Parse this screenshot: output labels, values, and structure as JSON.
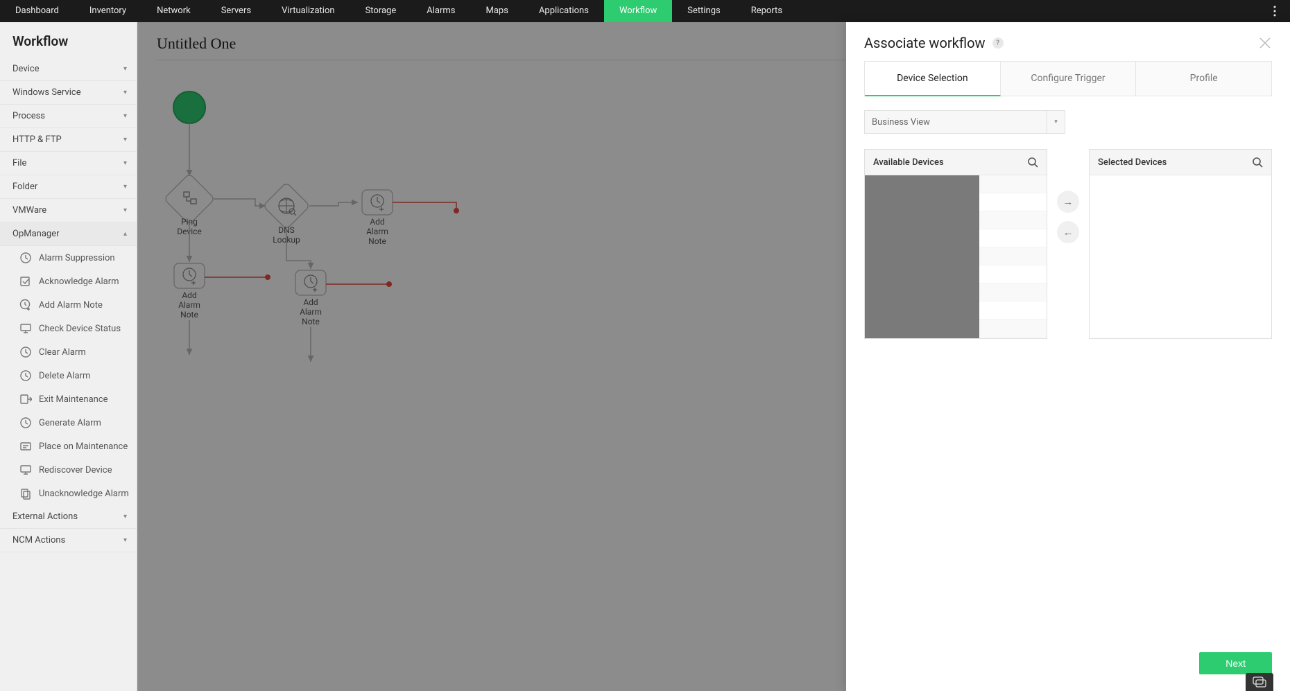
{
  "topnav": {
    "items": [
      {
        "label": "Dashboard"
      },
      {
        "label": "Inventory"
      },
      {
        "label": "Network"
      },
      {
        "label": "Servers"
      },
      {
        "label": "Virtualization"
      },
      {
        "label": "Storage"
      },
      {
        "label": "Alarms"
      },
      {
        "label": "Maps"
      },
      {
        "label": "Applications"
      },
      {
        "label": "Workflow",
        "active": true
      },
      {
        "label": "Settings"
      },
      {
        "label": "Reports"
      }
    ]
  },
  "sidebar": {
    "title": "Workflow",
    "categories": [
      {
        "label": "Device"
      },
      {
        "label": "Windows Service"
      },
      {
        "label": "Process"
      },
      {
        "label": "HTTP & FTP"
      },
      {
        "label": "File"
      },
      {
        "label": "Folder"
      },
      {
        "label": "VMWare"
      }
    ],
    "expanded_category_label": "OpManager",
    "expanded_items": [
      {
        "label": "Alarm Suppression"
      },
      {
        "label": "Acknowledge Alarm"
      },
      {
        "label": "Add Alarm Note"
      },
      {
        "label": "Check Device Status"
      },
      {
        "label": "Clear Alarm"
      },
      {
        "label": "Delete Alarm"
      },
      {
        "label": "Exit Maintenance"
      },
      {
        "label": "Generate Alarm"
      },
      {
        "label": "Place on Maintenance"
      },
      {
        "label": "Rediscover Device"
      },
      {
        "label": "Unacknowledge Alarm"
      }
    ],
    "trailing_categories": [
      {
        "label": "External Actions"
      },
      {
        "label": "NCM Actions"
      }
    ]
  },
  "canvas": {
    "title": "Untitled One",
    "nodes": {
      "ping_device_l1": "Ping",
      "ping_device_l2": "Device",
      "dns_lookup_l1": "DNS",
      "dns_lookup_l2": "Lookup",
      "add_alarm_note_a_l1": "Add",
      "add_alarm_note_a_l2": "Alarm",
      "add_alarm_note_a_l3": "Note",
      "add_alarm_note_b_l1": "Add",
      "add_alarm_note_b_l2": "Alarm",
      "add_alarm_note_b_l3": "Note",
      "add_alarm_note_c_l1": "Add",
      "add_alarm_note_c_l2": "Alarm",
      "add_alarm_note_c_l3": "Note"
    }
  },
  "panel": {
    "title": "Associate workflow",
    "help": "?",
    "tabs": {
      "device_selection": "Device Selection",
      "configure_trigger": "Configure Trigger",
      "profile": "Profile"
    },
    "business_view_label": "Business View",
    "available_devices_label": "Available Devices",
    "selected_devices_label": "Selected Devices",
    "available_rows": [
      "",
      "",
      "",
      "",
      "",
      "",
      "",
      "",
      ""
    ],
    "next_label": "Next"
  }
}
